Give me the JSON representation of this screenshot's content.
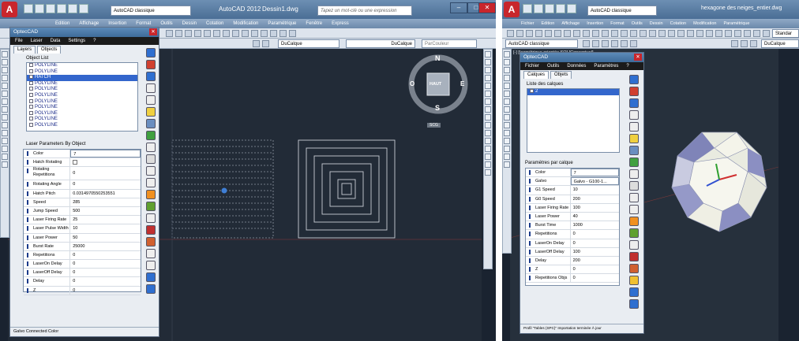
{
  "left": {
    "app_title": "AutoCAD 2012",
    "drawing_name": "Dessin1.dwg",
    "workspace": "AutoCAD classique",
    "search_placeholder": "Tapez un mot-clé ou une expression",
    "menu": [
      "Edition",
      "Affichage",
      "Insertion",
      "Format",
      "Outils",
      "Dessin",
      "Cotation",
      "Modification",
      "Paramétrique",
      "Fenêtre",
      "Express"
    ],
    "layer_combo": "DuCalque",
    "linetype_combo": "DuCalque",
    "color_combo": "ParCouleur",
    "viewcube": {
      "n": "N",
      "s": "S",
      "e": "E",
      "o": "O",
      "face": "HAUT",
      "scu": "SCG"
    },
    "panel": {
      "title": "OptecCAD",
      "menu": [
        "File",
        "Laser",
        "Data",
        "Settings",
        "?"
      ],
      "tabs": [
        "Layers",
        "Objects"
      ],
      "object_list_label": "Object List",
      "objects": [
        "POLYLINE",
        "POLYLINE",
        "HATCH",
        "POLYLINE",
        "POLYLINE",
        "POLYLINE",
        "POLYLINE",
        "POLYLINE",
        "POLYLINE",
        "POLYLINE",
        "POLYLINE"
      ],
      "selected_index": 2,
      "params_label": "Laser Parameters By Object",
      "params": [
        {
          "name": "Color",
          "value": "7"
        },
        {
          "name": "Hatch Rotating",
          "value": ""
        },
        {
          "name": "Rotating Repetitions",
          "value": "0"
        },
        {
          "name": "Rotating Angle",
          "value": "0"
        },
        {
          "name": "Hatch Pitch",
          "value": "0.0314970550253551"
        },
        {
          "name": "Speed",
          "value": "285"
        },
        {
          "name": "Jump Speed",
          "value": "500"
        },
        {
          "name": "Laser Firing Rate",
          "value": "25"
        },
        {
          "name": "Laser Pulse Width",
          "value": "10"
        },
        {
          "name": "Laser Power",
          "value": "50"
        },
        {
          "name": "Burst Rate",
          "value": "25000"
        },
        {
          "name": "Repetitions",
          "value": "0"
        },
        {
          "name": "LaserOn Delay",
          "value": "0"
        },
        {
          "name": "LaserOff Delay",
          "value": "0"
        },
        {
          "name": "Delay",
          "value": "0"
        },
        {
          "name": "Z",
          "value": "0"
        }
      ],
      "status": "Galvo Connected   Color"
    }
  },
  "right": {
    "app_title": "AutoCAD classique",
    "drawing_name": "hexagone des neiges_entier.dwg",
    "workspace": "AutoCAD classique",
    "menu": [
      "Fichier",
      "Edition",
      "Affichage",
      "Insertion",
      "Format",
      "Outils",
      "Dessin",
      "Cotation",
      "Modification",
      "Paramétrique"
    ],
    "standard_label": "Standar",
    "layer_combo": "DuCalque",
    "viewport_label": "[-] [Isométrique orientée SO] [Conceptuel]",
    "panel": {
      "title": "OptecCAD",
      "menu": [
        "Fichier",
        "Outils",
        "Données",
        "Paramètres",
        "?"
      ],
      "tabs": [
        "Calques",
        "Objets"
      ],
      "list_label": "Liste des calques",
      "layers": [
        "2"
      ],
      "params_label": "Paramètres par calque",
      "params": [
        {
          "name": "Color",
          "value": "7"
        },
        {
          "name": "Galvo",
          "value": "Galvo - G100-1..."
        },
        {
          "name": "G1 Speed",
          "value": "10"
        },
        {
          "name": "G0 Speed",
          "value": "200"
        },
        {
          "name": "Laser Firing Rate",
          "value": "100"
        },
        {
          "name": "Laser Power",
          "value": "40"
        },
        {
          "name": "Burst Time",
          "value": "1000"
        },
        {
          "name": "Repetitions",
          "value": "0"
        },
        {
          "name": "LaserOn Delay",
          "value": "0"
        },
        {
          "name": "LaserOff Delay",
          "value": "100"
        },
        {
          "name": "Delay",
          "value": "200"
        },
        {
          "name": "Z",
          "value": "0"
        },
        {
          "name": "Repetitions Objs",
          "value": "0"
        }
      ],
      "status": "Profil \"Tables (SPC)\"   Importation terminée   À jour"
    }
  },
  "colors": {
    "canvas": "#222b37",
    "selection": "#3366cc",
    "autocad_red": "#c8262c"
  }
}
